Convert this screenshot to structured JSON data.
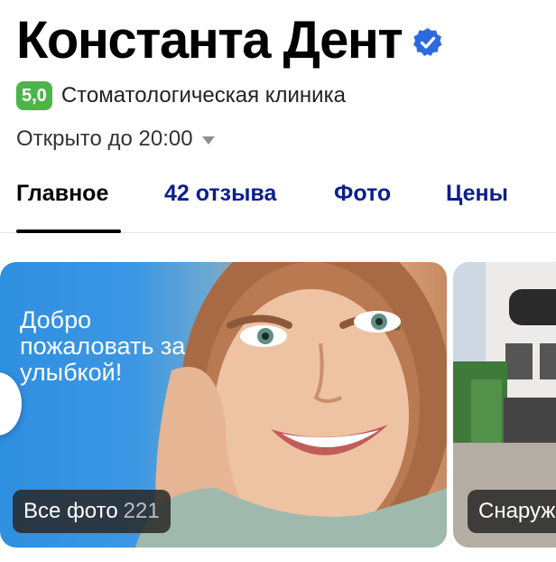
{
  "header": {
    "title": "Константа Дент",
    "verified_icon": "verified-badge-icon"
  },
  "rating": {
    "value": "5,0",
    "category": "Стоматологическая клиника",
    "badge_color": "#4cb54a"
  },
  "hours": {
    "text": "Открыто до 20:00",
    "caret_icon": "chevron-down-icon"
  },
  "tabs": [
    {
      "label": "Главное",
      "active": true
    },
    {
      "label": "42 отзыва",
      "active": false
    },
    {
      "label": "Фото",
      "active": false
    },
    {
      "label": "Цены",
      "active": false
    }
  ],
  "photos": {
    "main": {
      "promo_text": "Добро пожаловать за улыбкой!",
      "label": "Все фото",
      "count": "221"
    },
    "second": {
      "label": "Снаружи"
    }
  },
  "colors": {
    "tab_link": "#0a1e8c",
    "verified": "#2d6ae0"
  }
}
